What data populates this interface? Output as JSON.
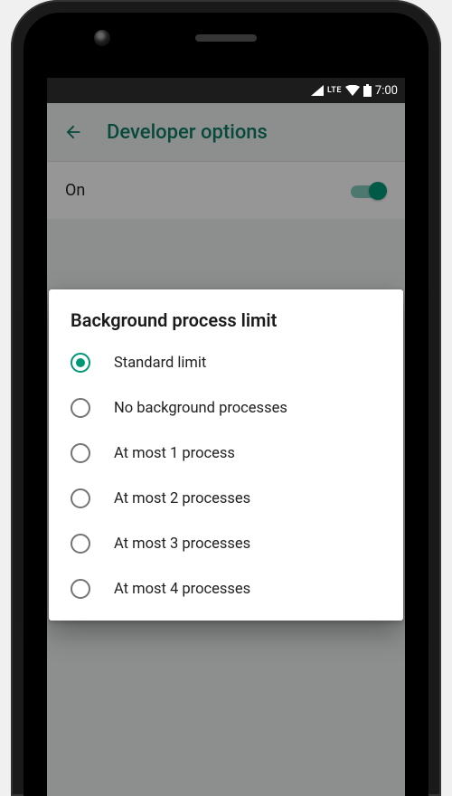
{
  "statusbar": {
    "network_label": "LTE",
    "time": "7:00"
  },
  "appbar": {
    "title": "Developer options"
  },
  "master_toggle": {
    "label": "On",
    "enabled": true
  },
  "dialog": {
    "title": "Background process limit",
    "selected_index": 0,
    "options": [
      {
        "label": "Standard limit"
      },
      {
        "label": "No background processes"
      },
      {
        "label": "At most 1 process"
      },
      {
        "label": "At most 2 processes"
      },
      {
        "label": "At most 3 processes"
      },
      {
        "label": "At most 4 processes"
      }
    ]
  },
  "colors": {
    "accent": "#009777"
  }
}
